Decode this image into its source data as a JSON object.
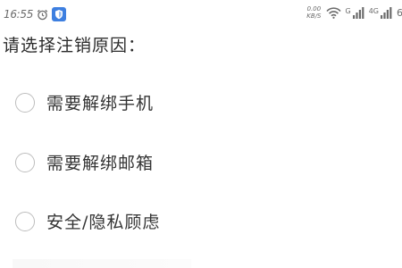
{
  "status_bar": {
    "time": "16:55",
    "alarm_icon": "alarm-clock-icon",
    "shield_icon": "shield-app-icon",
    "shield_color": "#3d7fe0",
    "net_speed_value": "0.00",
    "net_speed_unit": "KB/S",
    "wifi_icon": "wifi-icon",
    "sim1_label": "G",
    "sim2_label": "4G",
    "battery_partial": "6"
  },
  "form": {
    "prompt": "请选择注销原因：",
    "options": [
      {
        "label": "需要解绑手机",
        "checked": false
      },
      {
        "label": "需要解绑邮箱",
        "checked": false
      },
      {
        "label": "安全/隐私顾虑",
        "checked": false
      }
    ]
  }
}
